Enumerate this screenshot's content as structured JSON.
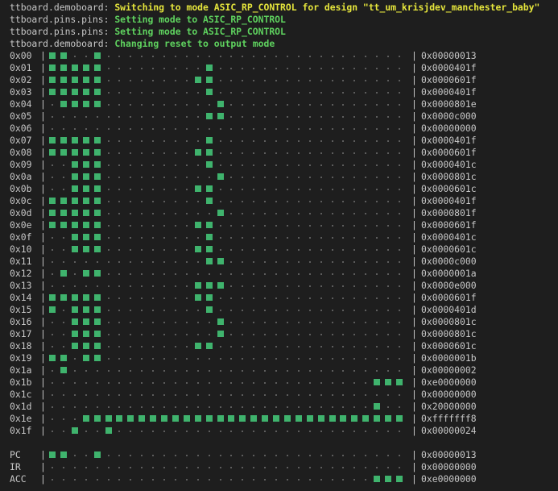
{
  "colors": {
    "background": "#1e1e1e",
    "text": "#c8c8c8",
    "cell_on": "#3fb36d",
    "cell_off": "#5c5c5c",
    "log_yellow": "#e6e63c",
    "log_green": "#5fd35f"
  },
  "log": [
    {
      "source": "ttboard.demoboard:",
      "message": "Switching to mode ASIC_RP_CONTROL for design \"tt_um_krisjdev_manchester_baby\"",
      "color": "#e6e63c"
    },
    {
      "source": "ttboard.pins.pins:",
      "message": "Setting mode to ASIC_RP_CONTROL",
      "color": "#5fd35f"
    },
    {
      "source": "ttboard.pins.pins:",
      "message": "Setting mode to ASIC_RP_CONTROL",
      "color": "#5fd35f"
    },
    {
      "source": "ttboard.demoboard:",
      "message": "Changing reset to output mode",
      "color": "#5fd35f"
    }
  ],
  "bits_per_word": 32,
  "separator": "|",
  "memory": [
    {
      "addr": "0x00",
      "hex": "0x00000013"
    },
    {
      "addr": "0x01",
      "hex": "0x0000401f"
    },
    {
      "addr": "0x02",
      "hex": "0x0000601f"
    },
    {
      "addr": "0x03",
      "hex": "0x0000401f"
    },
    {
      "addr": "0x04",
      "hex": "0x0000801e"
    },
    {
      "addr": "0x05",
      "hex": "0x0000c000"
    },
    {
      "addr": "0x06",
      "hex": "0x00000000"
    },
    {
      "addr": "0x07",
      "hex": "0x0000401f"
    },
    {
      "addr": "0x08",
      "hex": "0x0000601f"
    },
    {
      "addr": "0x09",
      "hex": "0x0000401c"
    },
    {
      "addr": "0x0a",
      "hex": "0x0000801c"
    },
    {
      "addr": "0x0b",
      "hex": "0x0000601c"
    },
    {
      "addr": "0x0c",
      "hex": "0x0000401f"
    },
    {
      "addr": "0x0d",
      "hex": "0x0000801f"
    },
    {
      "addr": "0x0e",
      "hex": "0x0000601f"
    },
    {
      "addr": "0x0f",
      "hex": "0x0000401c"
    },
    {
      "addr": "0x10",
      "hex": "0x0000601c"
    },
    {
      "addr": "0x11",
      "hex": "0x0000c000"
    },
    {
      "addr": "0x12",
      "hex": "0x0000001a"
    },
    {
      "addr": "0x13",
      "hex": "0x0000e000"
    },
    {
      "addr": "0x14",
      "hex": "0x0000601f"
    },
    {
      "addr": "0x15",
      "hex": "0x0000401d"
    },
    {
      "addr": "0x16",
      "hex": "0x0000801c"
    },
    {
      "addr": "0x17",
      "hex": "0x0000801c"
    },
    {
      "addr": "0x18",
      "hex": "0x0000601c"
    },
    {
      "addr": "0x19",
      "hex": "0x0000001b"
    },
    {
      "addr": "0x1a",
      "hex": "0x00000002"
    },
    {
      "addr": "0x1b",
      "hex": "0xe0000000"
    },
    {
      "addr": "0x1c",
      "hex": "0x00000000"
    },
    {
      "addr": "0x1d",
      "hex": "0x20000000"
    },
    {
      "addr": "0x1e",
      "hex": "0xfffffff8"
    },
    {
      "addr": "0x1f",
      "hex": "0x00000024"
    }
  ],
  "registers": [
    {
      "name": "PC",
      "hex": "0x00000013"
    },
    {
      "name": "IR",
      "hex": "0x00000000"
    },
    {
      "name": "ACC",
      "hex": "0xe0000000"
    }
  ]
}
